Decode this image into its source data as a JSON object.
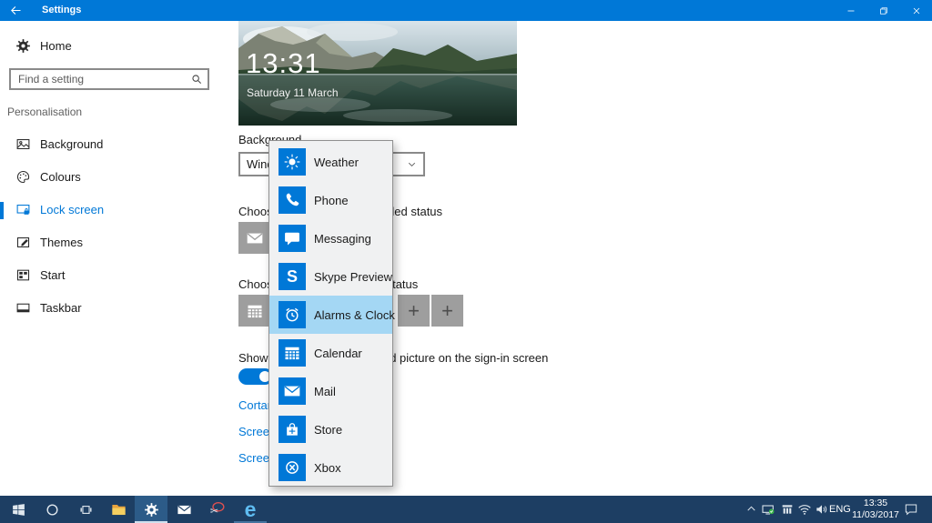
{
  "colors": {
    "accent": "#0078d7",
    "taskbar": "#1d3e63",
    "popup_highlight": "#a4d7f4"
  },
  "titlebar": {
    "title": "Settings"
  },
  "sidebar": {
    "home_label": "Home",
    "search_placeholder": "Find a setting",
    "section_header": "Personalisation",
    "items": [
      {
        "label": "Background"
      },
      {
        "label": "Colours"
      },
      {
        "label": "Lock screen",
        "selected": true
      },
      {
        "label": "Themes"
      },
      {
        "label": "Start"
      },
      {
        "label": "Taskbar"
      }
    ]
  },
  "lock_preview": {
    "time": "13:31",
    "date": "Saturday 11 March"
  },
  "content": {
    "background_label": "Background",
    "background_value": "Windows spotlight",
    "detailed_status_label": "Choose an app to show detailed status",
    "quick_status_label": "Choose apps to show quick status",
    "signin_label": "Show lock screen background picture on the sign-in screen",
    "add_glyph": "+",
    "links": {
      "cortana": "Cortana lock screen settings",
      "timeout": "Screen timeout settings",
      "screensaver": "Screen saver settings"
    }
  },
  "popup": {
    "items": [
      {
        "label": "Weather"
      },
      {
        "label": "Phone"
      },
      {
        "label": "Messaging"
      },
      {
        "label": "Skype Preview",
        "glyph": "S"
      },
      {
        "label": "Alarms & Clock",
        "selected": true
      },
      {
        "label": "Calendar"
      },
      {
        "label": "Mail"
      },
      {
        "label": "Store"
      },
      {
        "label": "Xbox"
      }
    ]
  },
  "taskbar": {
    "edge_glyph": "e",
    "snip_glyph": "✂",
    "tray": {
      "language": "ENG",
      "time": "13:35",
      "date": "11/03/2017"
    }
  }
}
